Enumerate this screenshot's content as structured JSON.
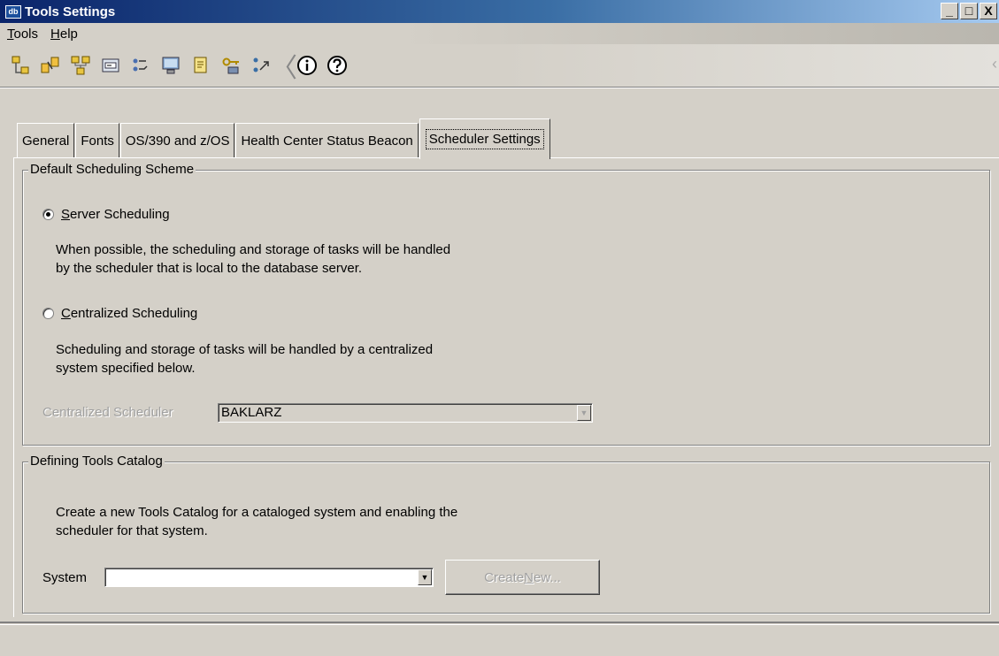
{
  "window": {
    "title": "Tools Settings",
    "icon_text": "db",
    "controls": {
      "minimize": "_",
      "maximize": "□",
      "close": "X"
    }
  },
  "menubar": {
    "items": [
      {
        "label": "Tools",
        "mnemonic": "T",
        "rest": "ools"
      },
      {
        "label": "Help",
        "mnemonic": "H",
        "rest": "elp"
      }
    ]
  },
  "toolbar": {
    "buttons": [
      {
        "icon": "control-center-icon"
      },
      {
        "icon": "replication-center-icon"
      },
      {
        "icon": "satellite-admin-center-icon"
      },
      {
        "icon": "command-editor-icon"
      },
      {
        "icon": "task-center-icon"
      },
      {
        "icon": "health-center-icon"
      },
      {
        "icon": "journal-icon"
      },
      {
        "icon": "license-center-icon"
      },
      {
        "icon": "development-center-icon"
      },
      {
        "icon": "info-icon"
      },
      {
        "icon": "help-icon"
      }
    ],
    "separator": "〈"
  },
  "tabs": [
    {
      "label": "General",
      "active": false
    },
    {
      "label": "Fonts",
      "active": false
    },
    {
      "label": "OS/390 and z/OS",
      "active": false
    },
    {
      "label": "Health Center Status Beacon",
      "active": false
    },
    {
      "label": "Scheduler Settings",
      "active": true
    }
  ],
  "scheduling_group": {
    "legend": "Default Scheduling Scheme",
    "server_option": {
      "mnemonic": "S",
      "rest": "erver Scheduling",
      "checked": true
    },
    "server_desc_1": "When possible, the scheduling and storage of tasks will be handled",
    "server_desc_2": "by the scheduler that is local to the database server.",
    "central_option": {
      "mnemonic": "C",
      "rest": "entralized Scheduling",
      "checked": false
    },
    "central_desc_1": "Scheduling and storage of tasks will be handled by a centralized",
    "central_desc_2": "system specified below.",
    "scheduler_label": "Centralized Scheduler",
    "scheduler_value": "BAKLARZ"
  },
  "catalog_group": {
    "legend": "Defining Tools Catalog",
    "desc_1": "Create a new Tools Catalog for a cataloged system and enabling the",
    "desc_2": "scheduler for that system.",
    "system_label": "System",
    "system_value": "",
    "create_button": {
      "before": "Create ",
      "mnemonic": "N",
      "after": "ew..."
    }
  },
  "colors": {
    "title_gradient_start": "#0a246a",
    "title_gradient_end": "#a6caf0",
    "face": "#d4d0c8",
    "disabled_text": "#a0a0a0"
  }
}
